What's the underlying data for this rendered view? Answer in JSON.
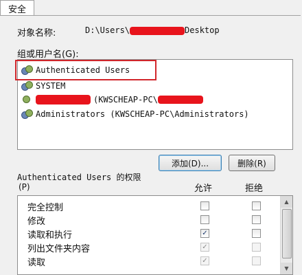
{
  "tab": {
    "label": "安全"
  },
  "object": {
    "label": "对象名称:",
    "path_prefix": "D:\\Users\\",
    "path_suffix": "Desktop"
  },
  "groups": {
    "label": "组或用户名(G):",
    "items": [
      {
        "name": "Authenticated Users",
        "selected": true
      },
      {
        "name": "SYSTEM"
      },
      {
        "name_suffix": "(KWSCHEAP-PC\\"
      },
      {
        "name": "Administrators (KWSCHEAP-PC\\Administrators)"
      }
    ]
  },
  "buttons": {
    "add": "添加(D)...",
    "remove": "删除(R)"
  },
  "permissions": {
    "title": "Authenticated Users 的权限",
    "mnemonic": "(P)",
    "allow": "允许",
    "deny": "拒绝",
    "rows": [
      {
        "label": "完全控制",
        "allow": false,
        "deny": false,
        "inherited": false
      },
      {
        "label": "修改",
        "allow": false,
        "deny": false,
        "inherited": false
      },
      {
        "label": "读取和执行",
        "allow": true,
        "deny": false,
        "inherited": false
      },
      {
        "label": "列出文件夹内容",
        "allow": true,
        "deny": false,
        "inherited": true
      },
      {
        "label": "读取",
        "allow": true,
        "deny": false,
        "inherited": true
      }
    ]
  },
  "colors": {
    "highlight": "#d1262b",
    "redaction": "#e8141c"
  }
}
